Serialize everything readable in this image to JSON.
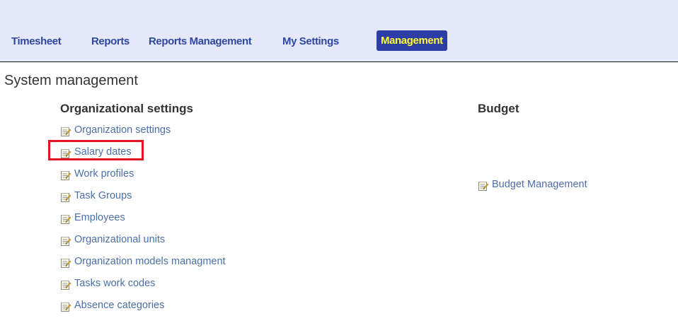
{
  "nav": {
    "items": [
      {
        "label": "Timesheet"
      },
      {
        "label": "Reports"
      },
      {
        "label": "Reports Management"
      },
      {
        "label": "My Settings"
      },
      {
        "label": "Management"
      }
    ]
  },
  "page": {
    "title": "System management"
  },
  "organizational": {
    "heading": "Organizational settings",
    "links": [
      {
        "label": "Organization settings"
      },
      {
        "label": "Salary dates"
      },
      {
        "label": "Work profiles"
      },
      {
        "label": "Task Groups"
      },
      {
        "label": "Employees"
      },
      {
        "label": "Organizational units"
      },
      {
        "label": "Organization models managment"
      },
      {
        "label": "Tasks work codes"
      },
      {
        "label": "Absence categories"
      }
    ]
  },
  "budget": {
    "heading": "Budget",
    "links": [
      {
        "label": "Budget Management"
      }
    ]
  },
  "colors": {
    "topbar_bg": "#e4e8f8",
    "nav_text": "#2f47a0",
    "active_bg": "#2c3ea6",
    "active_text": "#ffff33",
    "link_text": "#4a6fa8",
    "highlight": "#e1141f"
  },
  "icons": {
    "link_icon": "edit-note-icon"
  }
}
